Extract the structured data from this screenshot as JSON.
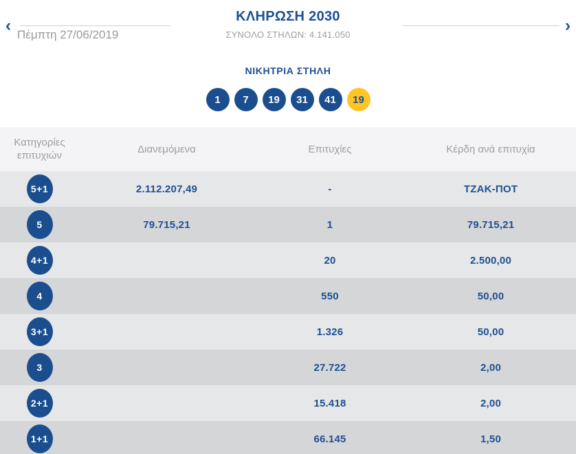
{
  "colors": {
    "accent_blue": "#1a4e8e",
    "title_blue": "#1d4f91",
    "joker_yellow": "#ffc425",
    "row_light": "#e6e7e9",
    "row_dark": "#d5d6d8",
    "header_bg": "#f4f4f6",
    "muted_gray": "#9b9da0"
  },
  "header": {
    "title": "ΚΛΗΡΩΣΗ 2030",
    "subtitle": "ΣΥΝΟΛΟ ΣΤΗΛΩΝ: 4.141.050",
    "date": "Πέμπτη 27/06/2019",
    "prev_arrow": "‹",
    "next_arrow": "›"
  },
  "winning": {
    "label": "ΝΙΚΗΤΡΙΑ ΣΤΗΛΗ",
    "numbers": [
      "1",
      "7",
      "19",
      "31",
      "41"
    ],
    "joker": "19"
  },
  "table": {
    "headers": {
      "category_line1": "Κατηγορίες",
      "category_line2": "επιτυχιών",
      "distributed": "Διανεμόμενα",
      "wins": "Επιτυχίες",
      "prize": "Κέρδη ανά επιτυχία"
    },
    "rows": [
      {
        "category": "5+1",
        "distributed": "2.112.207,49",
        "wins": "-",
        "prize": "ΤΖΑΚ-ΠΟΤ"
      },
      {
        "category": "5",
        "distributed": "79.715,21",
        "wins": "1",
        "prize": "79.715,21"
      },
      {
        "category": "4+1",
        "distributed": "",
        "wins": "20",
        "prize": "2.500,00"
      },
      {
        "category": "4",
        "distributed": "",
        "wins": "550",
        "prize": "50,00"
      },
      {
        "category": "3+1",
        "distributed": "",
        "wins": "1.326",
        "prize": "50,00"
      },
      {
        "category": "3",
        "distributed": "",
        "wins": "27.722",
        "prize": "2,00"
      },
      {
        "category": "2+1",
        "distributed": "",
        "wins": "15.418",
        "prize": "2,00"
      },
      {
        "category": "1+1",
        "distributed": "",
        "wins": "66.145",
        "prize": "1,50"
      }
    ]
  }
}
